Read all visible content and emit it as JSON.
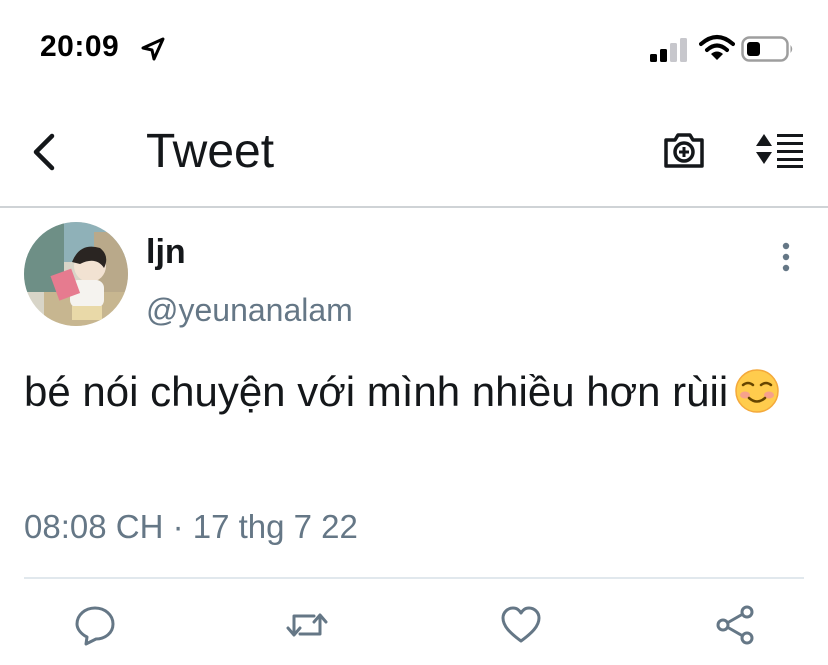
{
  "status_bar": {
    "time": "20:09",
    "icons": [
      "location-arrow-icon",
      "signal-icon",
      "wifi-icon",
      "battery-icon"
    ]
  },
  "header": {
    "title": "Tweet",
    "icons": [
      "back-chevron-icon",
      "camera-plus-icon",
      "sort-icon"
    ]
  },
  "tweet": {
    "name": "ljn",
    "handle": "@yeunanalam",
    "text": "bé nói chuyện với mình nhiều hơn rùii",
    "emoji": "☺️",
    "timestamp": "08:08 CH · 17 thg 7 22"
  },
  "actions": [
    "reply-icon",
    "retweet-icon",
    "like-icon",
    "share-icon"
  ],
  "colors": {
    "text": "#14171a",
    "secondary": "#657786",
    "divider": "#cfd3d6"
  }
}
